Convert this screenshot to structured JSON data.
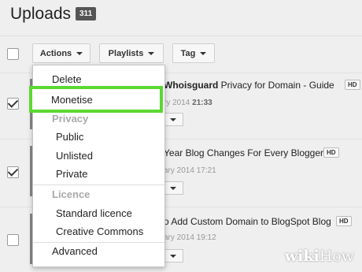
{
  "header": {
    "title": "Uploads",
    "count": "311"
  },
  "toolbar": {
    "actions_label": "Actions",
    "playlists_label": "Playlists",
    "tag_label": "Tag"
  },
  "videos": [
    {
      "title_bold": "Whoisguard",
      "title_rest": " Privacy for Domain - Guide",
      "hd": "HD",
      "date": "ry 2014 ",
      "time": "21:33",
      "checked": true
    },
    {
      "title_rest": "Year Blog Changes For Every Blogger",
      "hd": "HD",
      "date": "ary 2014 17:21",
      "checked": true
    },
    {
      "title_rest": "o Add Custom Domain to BlogSpot Blog",
      "hd": "HD",
      "date": "ary 2014 19:12",
      "checked": false
    }
  ],
  "menu": {
    "delete": "Delete",
    "monetise": "Monetise",
    "privacy_header": "Privacy",
    "public": "Public",
    "unlisted": "Unlisted",
    "private": "Private",
    "licence_header": "Licence",
    "standard_licence": "Standard licence",
    "creative_commons": "Creative Commons",
    "advanced": "Advanced"
  },
  "watermark": {
    "part1": "wiki",
    "part2": "How"
  },
  "colors": {
    "highlight": "#5cd832",
    "badge": "#555555",
    "background": "#efefef"
  },
  "icons": [
    "chevron-down-icon",
    "checkmark-icon"
  ]
}
